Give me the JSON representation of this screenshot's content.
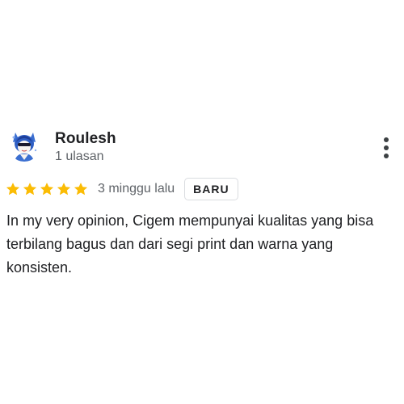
{
  "review": {
    "reviewer_name": "Roulesh",
    "review_count": "1 ulasan",
    "avatar_icon": "anime-character-avatar",
    "more_icon": "more-vert-icon",
    "rating": 5,
    "rating_max": 5,
    "star_color": "#fbbc04",
    "date": "3 minggu lalu",
    "badge": "BARU",
    "text": "In my very opinion, Cigem mempunyai kualitas yang bisa terbilang bagus dan dari segi print dan warna yang konsisten."
  }
}
